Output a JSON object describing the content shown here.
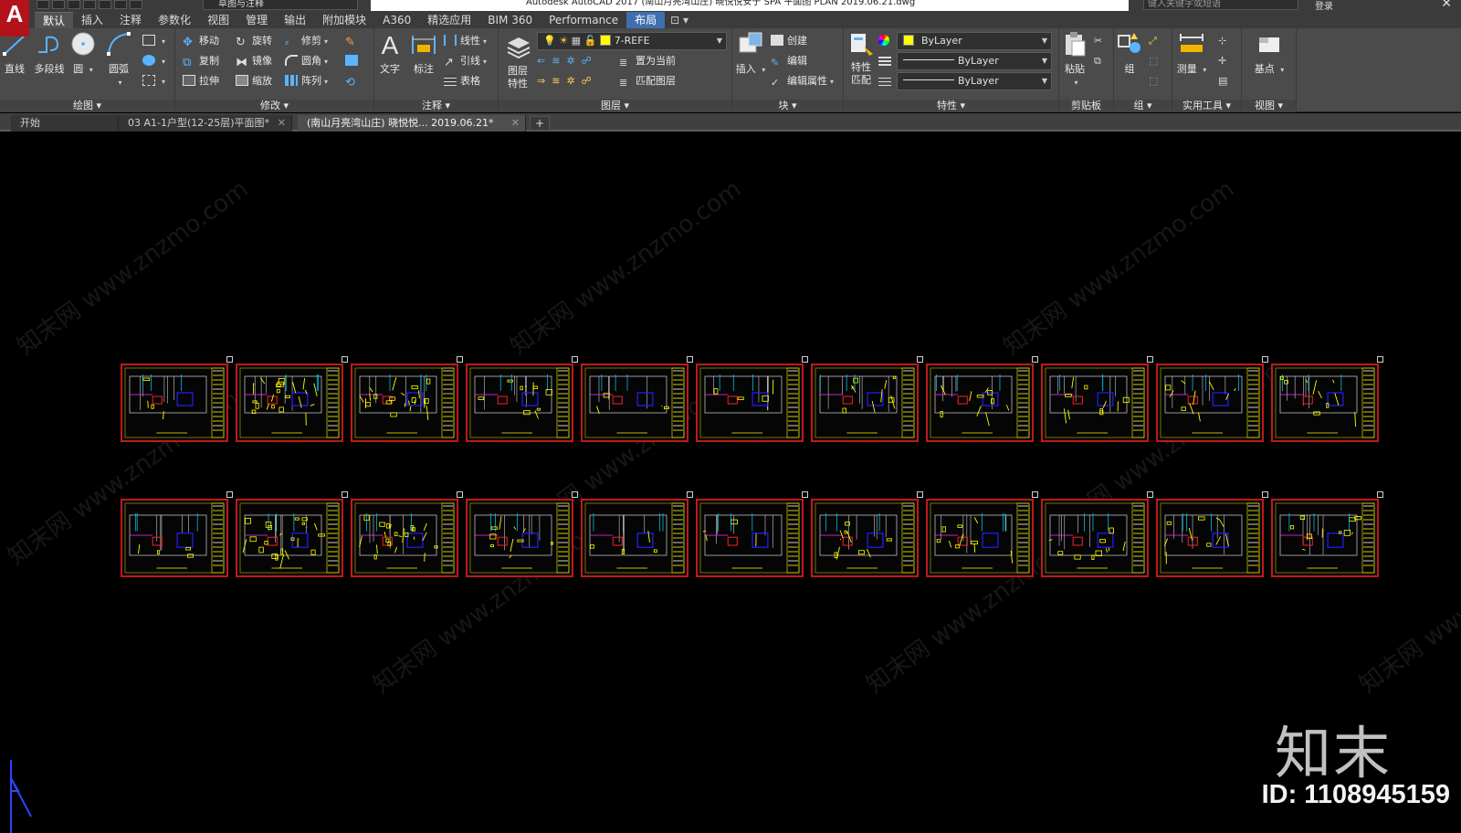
{
  "titlebar": {
    "workspace": "草图与注释",
    "title": "Autodesk AutoCAD 2017    (南山月亮湾山庄) 晓悦悦安于 SPA 平面图 PLAN 2019.06.21.dwg",
    "search_placeholder": "键入关键字或短语",
    "login": "登录",
    "close": "✕"
  },
  "ribbon_tabs": [
    "默认",
    "插入",
    "注释",
    "参数化",
    "视图",
    "管理",
    "输出",
    "附加模块",
    "A360",
    "精选应用",
    "BIM 360",
    "Performance",
    "布局"
  ],
  "ribbon_tab_extra": "⊡ ▾",
  "ribbon": {
    "draw": {
      "footer": "绘图",
      "line": "直线",
      "polyline": "多段线",
      "circle": "圆",
      "arc": "圆弧"
    },
    "modify": {
      "footer": "修改",
      "move": "移动",
      "rotate": "旋转",
      "trim": "修剪",
      "copy": "复制",
      "mirror": "镜像",
      "fillet": "圆角",
      "stretch": "拉伸",
      "scale": "缩放",
      "array": "阵列"
    },
    "annotation": {
      "footer": "注释",
      "text": "文字",
      "dimension": "标注",
      "linear": "线性",
      "leader": "引线",
      "table": "表格"
    },
    "layers": {
      "footer": "图层",
      "layer_props": "图层\n特性",
      "current_layer": "7-REFE",
      "make_current": "置为当前",
      "match_layer": "匹配图层"
    },
    "block": {
      "footer": "块",
      "insert": "插入",
      "create": "创建",
      "edit": "编辑",
      "edit_attr": "编辑属性"
    },
    "properties": {
      "footer": "特性",
      "match": "特性\n匹配",
      "color": "ByLayer",
      "linetype": "ByLayer",
      "lineweight": "ByLayer"
    },
    "clipboard": {
      "footer": "剪贴板",
      "paste": "粘贴"
    },
    "groups": {
      "footer": "组",
      "group": "组"
    },
    "utilities": {
      "footer": "实用工具",
      "measure": "测量"
    },
    "view": {
      "footer": "视图",
      "base": "基点"
    }
  },
  "file_tabs": [
    {
      "label": "开始"
    },
    {
      "label": "03 A1-1户型(12-25层)平面图*"
    },
    {
      "label": "(南山月亮湾山庄) 晓悦悦... 2019.06.21*"
    }
  ],
  "file_tab_add": "+",
  "watermark_text": "知末网 www.znzmo.com",
  "brand": {
    "logo": "知末",
    "id": "ID: 1108945159"
  },
  "colors": {
    "sheet_border": "#c0181f",
    "drawing_yellow": "#ffff00",
    "drawing_blue": "#2020ff",
    "drawing_red": "#ff2020",
    "drawing_cyan": "#00d8ff",
    "drawing_magenta": "#ff30ff"
  }
}
